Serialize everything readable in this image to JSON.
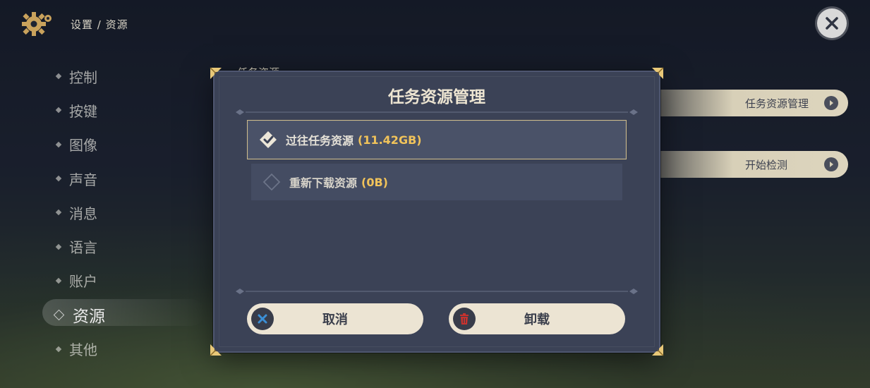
{
  "header": {
    "breadcrumb": "设置 / 资源"
  },
  "nav": {
    "items": [
      {
        "label": "控制"
      },
      {
        "label": "按键"
      },
      {
        "label": "图像"
      },
      {
        "label": "声音"
      },
      {
        "label": "消息"
      },
      {
        "label": "语言"
      },
      {
        "label": "账户"
      },
      {
        "label": "资源",
        "active": true
      },
      {
        "label": "其他"
      }
    ]
  },
  "background_panel": {
    "section_title": "任务资源",
    "buttons": [
      {
        "label": "任务资源管理"
      },
      {
        "label": "开始检测"
      }
    ]
  },
  "dialog": {
    "title": "任务资源管理",
    "options": [
      {
        "label": "过往任务资源",
        "size": "(11.42GB)",
        "checked": true
      },
      {
        "label": "重新下载资源",
        "size": "(0B)",
        "checked": false
      }
    ],
    "cancel_label": "取消",
    "uninstall_label": "卸载"
  },
  "colors": {
    "accent_gold": "#f1c35a",
    "dialog_bg": "#3b4256",
    "button_bg": "#ece4d3",
    "uninstall_icon": "#c8322e",
    "cancel_icon": "#3b8fd6"
  },
  "icons": [
    "gear-icon",
    "close-icon",
    "check-diamond-icon",
    "empty-diamond-icon",
    "cancel-x-icon",
    "trash-icon",
    "arrow-right-icon"
  ]
}
